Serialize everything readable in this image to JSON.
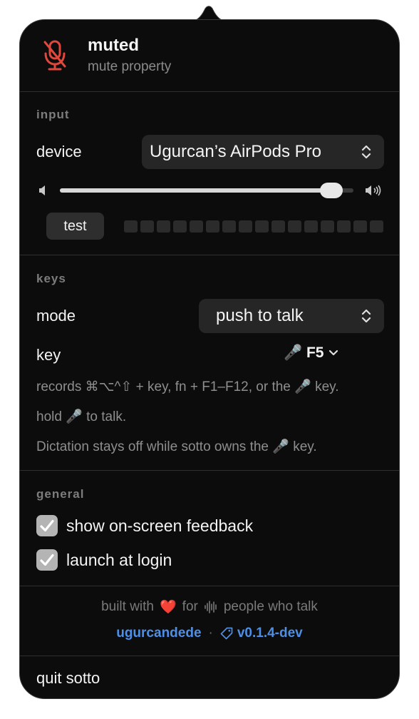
{
  "header": {
    "title": "muted",
    "subtitle": "mute property",
    "icon": "microphone-slash-icon",
    "icon_color": "#e0473d"
  },
  "input": {
    "section_label": "input",
    "device_label": "device",
    "device_value": "Ugurcan’s AirPods Pro",
    "volume_level": 0.96,
    "test_label": "test",
    "meter_segments": 16
  },
  "keys": {
    "section_label": "keys",
    "mode_label": "mode",
    "mode_value": "push to talk",
    "key_label": "key",
    "key_value": "🎤 F5",
    "hint_records": "records ⌘⌥^⇧ + key, fn + F1–F12, or the 🎤 key.",
    "hint_hold": "hold 🎤 to talk.",
    "hint_dictation": "Dictation stays off while sotto owns the 🎤 key."
  },
  "general": {
    "section_label": "general",
    "options": [
      {
        "label": "show on-screen feedback",
        "checked": true
      },
      {
        "label": "launch at login",
        "checked": true
      }
    ]
  },
  "footer": {
    "built_with": "built with",
    "heart": "❤️",
    "for_text": "for",
    "people_text": "people who talk",
    "author_link": "ugurcandede",
    "dot": "·",
    "version_link": "v0.1.4-dev",
    "link_color": "#4d8fe6"
  },
  "quit_label": "quit sotto"
}
